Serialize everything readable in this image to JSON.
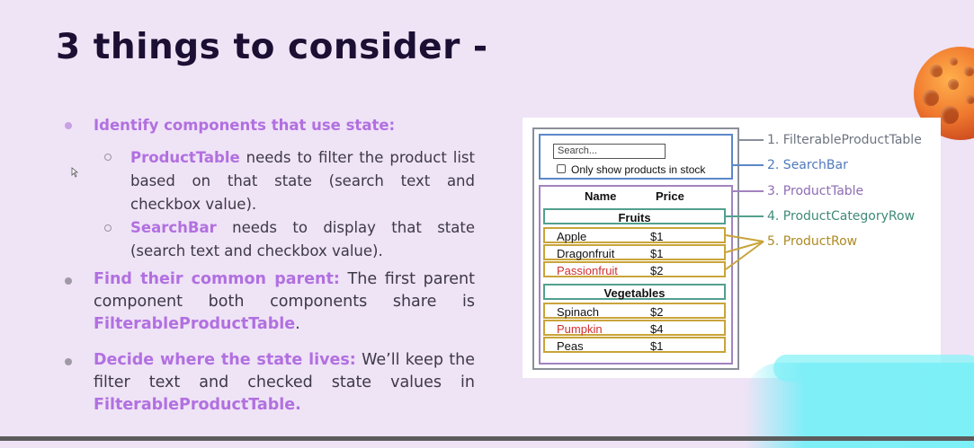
{
  "slide": {
    "title": "3 things to consider -"
  },
  "bullets": {
    "b1": {
      "heading": "Identify components that use state:",
      "sub1_name": "ProductTable",
      "sub1_text": " needs to filter the product list based on that state (search text and checkbox value).",
      "sub2_name": "SearchBar",
      "sub2_text": " needs to display that state (search text and checkbox value)."
    },
    "b2": {
      "heading": "Find their common parent:",
      "text": " The first parent component both components share is ",
      "emph": "FilterableProductTable",
      "end": "."
    },
    "b3": {
      "heading": "Decide where the state lives:",
      "text": " We’ll keep the filter text and checked state values in ",
      "emph": "FilterableProductTable."
    }
  },
  "diagram": {
    "search_placeholder": "Search...",
    "checkbox_label": "Only show products in stock",
    "col_name": "Name",
    "col_price": "Price",
    "cat1": "Fruits",
    "cat2": "Vegetables",
    "rows": [
      {
        "name": "Apple",
        "price": "$1"
      },
      {
        "name": "Dragonfruit",
        "price": "$1"
      },
      {
        "name": "Passionfruit",
        "price": "$2"
      },
      {
        "name": "Spinach",
        "price": "$2"
      },
      {
        "name": "Pumpkin",
        "price": "$4"
      },
      {
        "name": "Peas",
        "price": "$1"
      }
    ],
    "labels": {
      "l1": "1. FilterableProductTable",
      "l2": "2. SearchBar",
      "l3": "3. ProductTable",
      "l4": "4. ProductCategoryRow",
      "l5": "5. ProductRow"
    }
  },
  "colors": {
    "filterable": "#8a8f99",
    "searchbar": "#5c87c8",
    "producttable": "#a283c0",
    "categoryrow": "#52a08e",
    "productrow": "#c9a43a",
    "out_of_stock": "#d02f2f"
  }
}
